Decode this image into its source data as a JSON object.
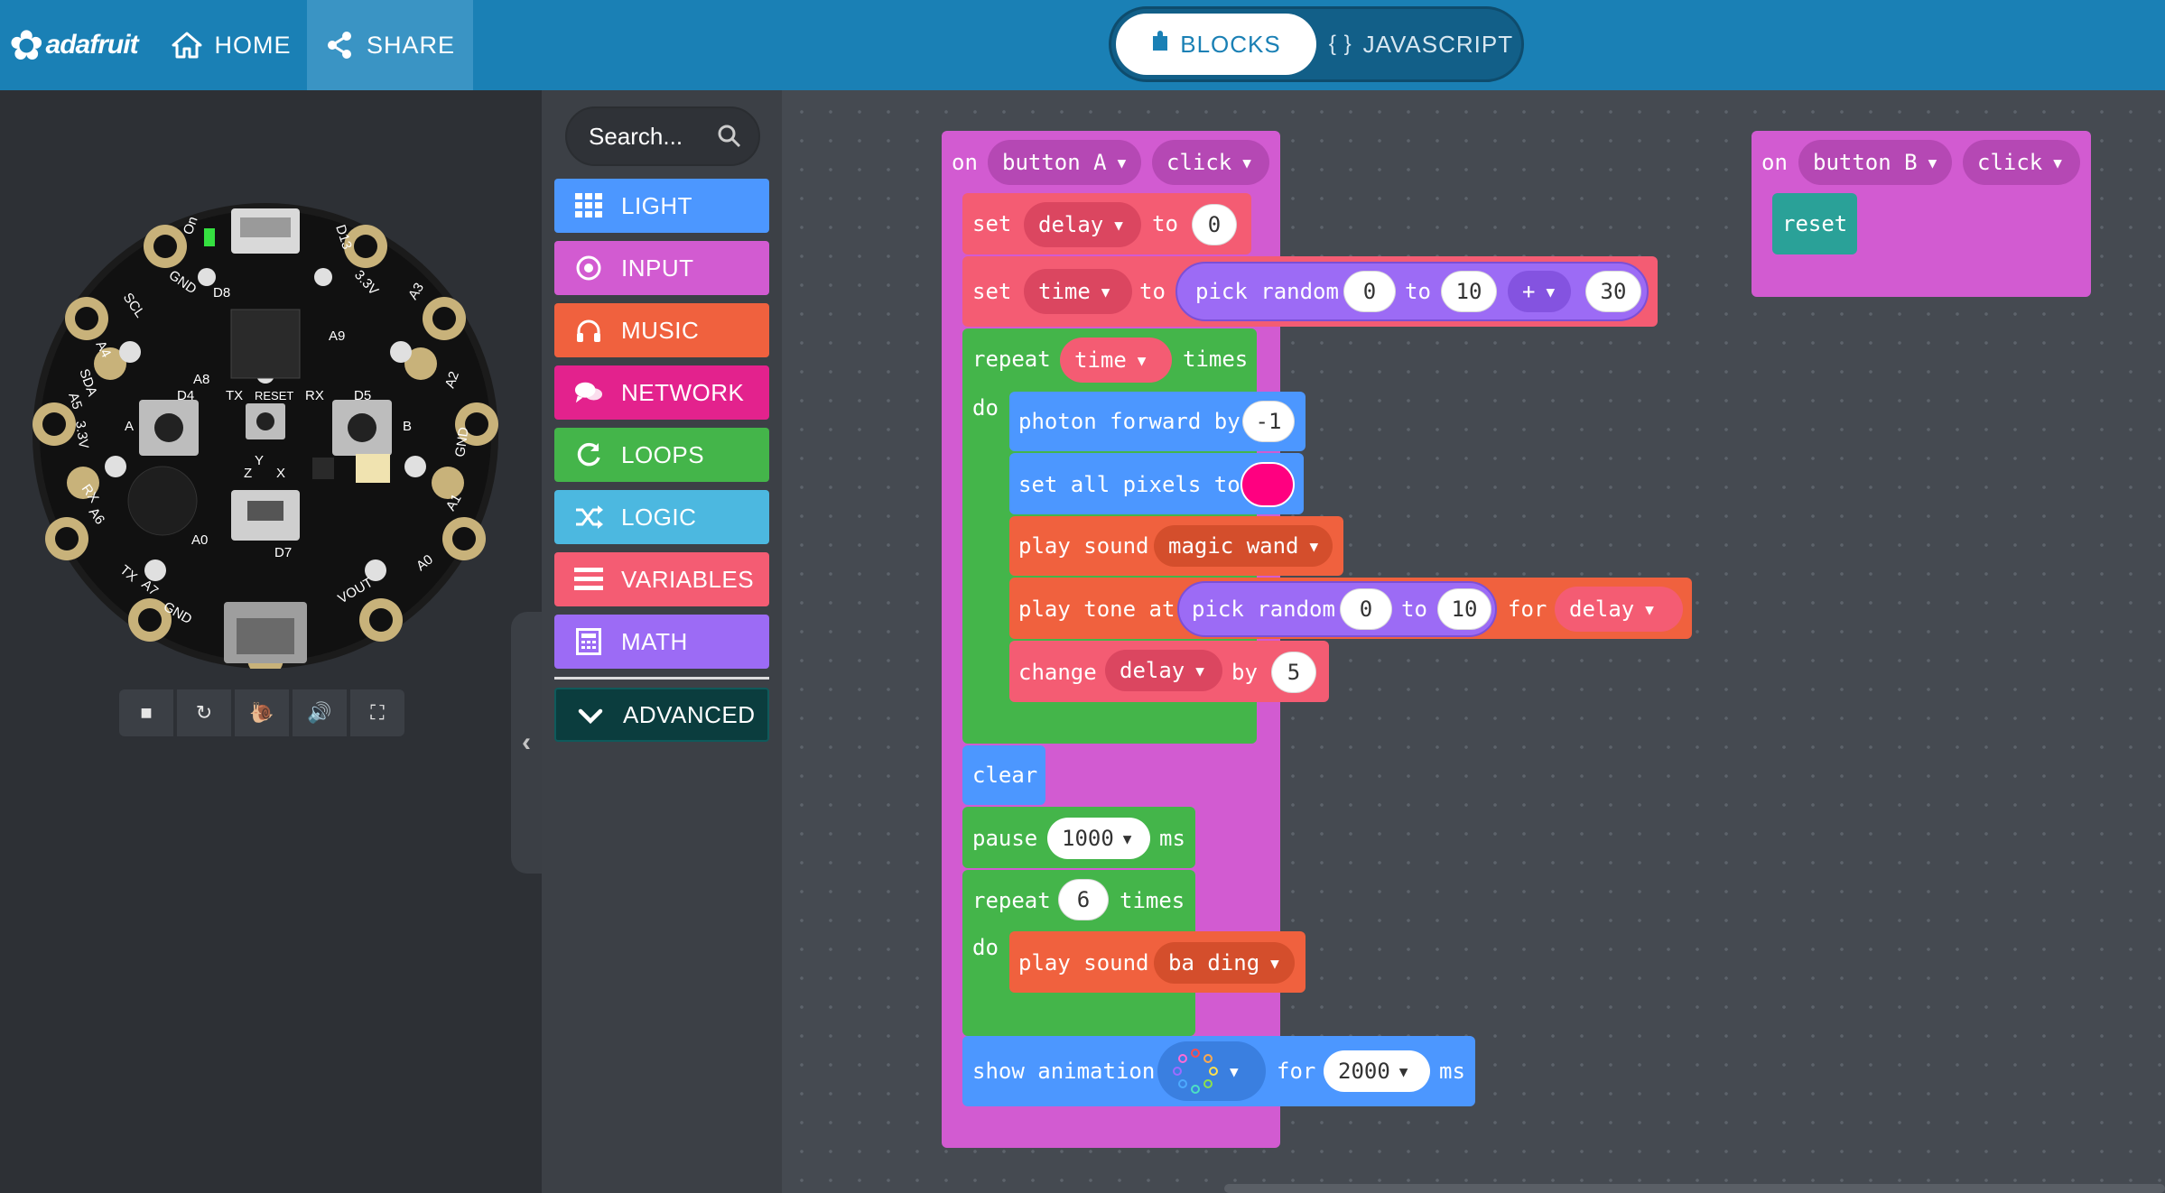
{
  "app": {
    "brand": "adafruit",
    "nav": {
      "home": "HOME",
      "share": "SHARE"
    },
    "editor_tabs": {
      "blocks": "BLOCKS",
      "javascript": "JAVASCRIPT"
    }
  },
  "simulator": {
    "pin_labels": [
      "On",
      "D13",
      "GND",
      "3.3V",
      "D8",
      "SCL",
      "A4",
      "A3",
      "A9",
      "SDA",
      "A5",
      "A2",
      "D4",
      "TX",
      "RESET",
      "RX",
      "D5",
      "A8",
      "3.3V",
      "GND",
      "A",
      "B",
      "Y",
      "Z",
      "X",
      "RX",
      "A6",
      "A1",
      "A0",
      "TX",
      "A7",
      "D7",
      "A0",
      "GND",
      "VOUT"
    ],
    "controls": [
      "stop-icon",
      "restart-icon",
      "slow-motion-icon",
      "sound-icon",
      "fullscreen-icon"
    ]
  },
  "toolbox": {
    "search_placeholder": "Search...",
    "categories": [
      {
        "label": "LIGHT",
        "color": "#4c97ff",
        "icon": "grid-icon"
      },
      {
        "label": "INPUT",
        "color": "#d25bd1",
        "icon": "radio-icon"
      },
      {
        "label": "MUSIC",
        "color": "#f0613e",
        "icon": "headphones-icon"
      },
      {
        "label": "NETWORK",
        "color": "#e3228d",
        "icon": "chat-icon"
      },
      {
        "label": "LOOPS",
        "color": "#44b54a",
        "icon": "refresh-icon"
      },
      {
        "label": "LOGIC",
        "color": "#4cb8e0",
        "icon": "shuffle-icon"
      },
      {
        "label": "VARIABLES",
        "color": "#f45c73",
        "icon": "list-icon"
      },
      {
        "label": "MATH",
        "color": "#9c6bf5",
        "icon": "calculator-icon"
      }
    ],
    "advanced": "ADVANCED"
  },
  "workspace": {
    "event_a": {
      "on": "on",
      "button": "button A",
      "action": "click"
    },
    "set_delay": {
      "set": "set",
      "var": "delay",
      "to": "to",
      "value": "0"
    },
    "set_time": {
      "set": "set",
      "var": "time",
      "to": "to",
      "pick": "pick random",
      "from": "0",
      "to2": "to",
      "max": "10",
      "op": "+",
      "addend": "30"
    },
    "repeat_time": {
      "repeat": "repeat",
      "var": "time",
      "times": "times",
      "do": "do"
    },
    "photon": {
      "label": "photon forward by",
      "value": "-1"
    },
    "set_pixels": {
      "label": "set all pixels to",
      "color": "#ff0080"
    },
    "sound_wand": {
      "label": "play sound",
      "sound": "magic wand"
    },
    "tone": {
      "label": "play tone at",
      "pick": "pick random",
      "from": "0",
      "to": "to",
      "max": "10",
      "for": "for",
      "var": "delay"
    },
    "change": {
      "label": "change",
      "var": "delay",
      "by": "by",
      "value": "5"
    },
    "clear": "clear",
    "pause": {
      "label": "pause",
      "value": "1000",
      "unit": "ms"
    },
    "repeat_6": {
      "repeat": "repeat",
      "count": "6",
      "times": "times",
      "do": "do"
    },
    "sound_ding": {
      "label": "play sound",
      "sound": "ba ding"
    },
    "animation": {
      "label": "show animation",
      "for": "for",
      "duration": "2000",
      "unit": "ms"
    },
    "event_b": {
      "on": "on",
      "button": "button B",
      "action": "click",
      "reset": "reset"
    }
  }
}
